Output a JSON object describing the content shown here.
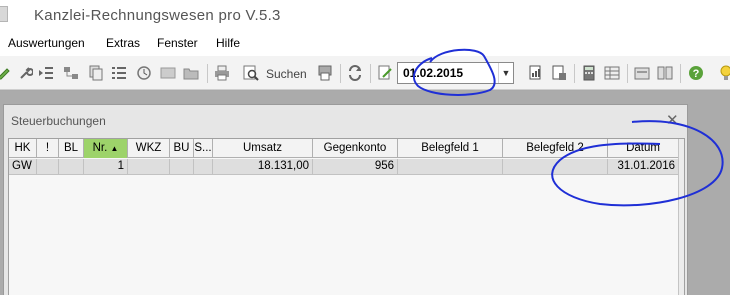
{
  "app": {
    "title": "Kanzlei-Rechnungswesen pro V.5.3"
  },
  "menu": {
    "items": [
      "Auswertungen",
      "Extras",
      "Fenster",
      "Hilfe"
    ]
  },
  "toolbar": {
    "search_label": "Suchen",
    "date_value": "01.02.2015"
  },
  "dialog": {
    "title": "Steuerbuchungen",
    "columns": [
      "HK",
      "!",
      "BL",
      "Nr.",
      "WKZ",
      "BU",
      "S...",
      "Umsatz",
      "Gegenkonto",
      "Belegfeld 1",
      "Belegfeld 2",
      "Datum"
    ],
    "rows": [
      {
        "hk": "GW",
        "nr": "1",
        "umsatz": "18.131,00",
        "gegenkonto": "956",
        "datum": "31.01.2016"
      }
    ]
  },
  "colors": {
    "sorted_column": "#9dd36a",
    "annotation_ink": "#1f2fd6",
    "accent": "#3a7bd5"
  },
  "icons": [
    "wrench-icon",
    "indent-icon",
    "copy-icon",
    "list-icon",
    "clock-icon",
    "folder-icon",
    "print-icon",
    "search-icon",
    "refresh-icon",
    "edit-icon",
    "calculator-icon",
    "report-icon",
    "help-icon",
    "lightbulb-icon"
  ]
}
